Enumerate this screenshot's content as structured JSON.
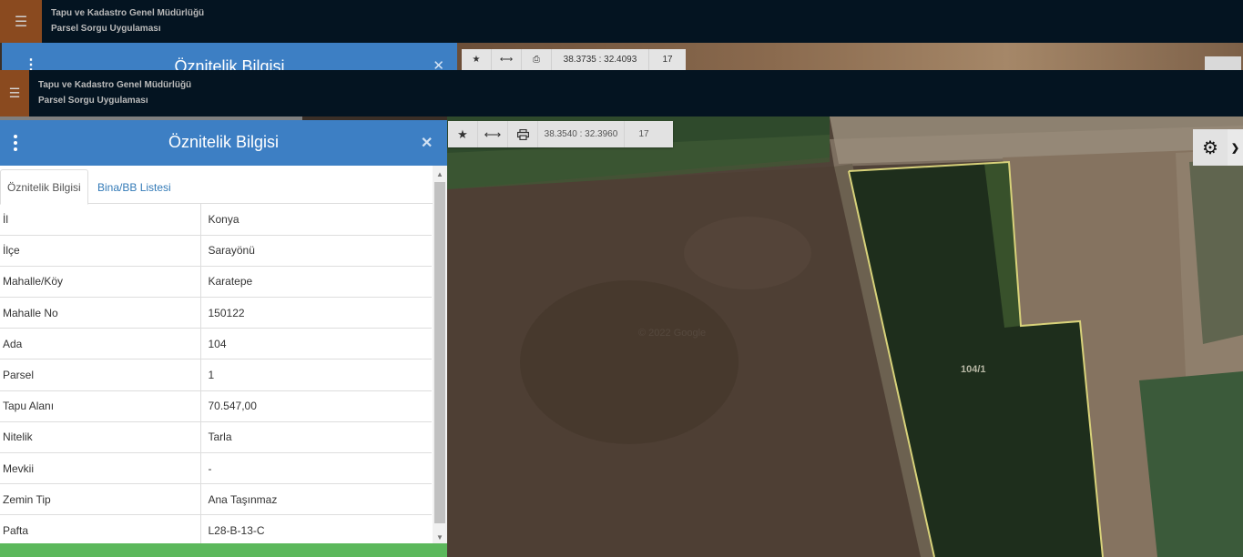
{
  "ghost": {
    "app_title_line1": "Tapu ve Kadastro Genel Müdürlüğü",
    "app_title_line2": "Parsel Sorgu Uygulaması",
    "panel_title": "Öznitelik Bilgisi",
    "coords": "38.3735 : 32.4093",
    "zoom": "17"
  },
  "header": {
    "menu_icon": "hamburger-icon",
    "title_line1": "Tapu ve Kadastro Genel Müdürlüğü",
    "title_line2": "Parsel Sorgu Uygulaması"
  },
  "toolbar": {
    "coords": "38.3540 : 32.3960",
    "zoom": "17",
    "icons": [
      "star-icon",
      "measure-icon",
      "print-icon"
    ]
  },
  "map": {
    "parcel_label": "104/1",
    "watermark": "© 2022 Google"
  },
  "panel": {
    "title": "Öznitelik Bilgisi",
    "tabs": [
      {
        "label": "Öznitelik Bilgisi",
        "active": true
      },
      {
        "label": "Bina/BB Listesi",
        "active": false
      }
    ],
    "rows": [
      {
        "key": "İl",
        "value": "Konya"
      },
      {
        "key": "İlçe",
        "value": "Sarayönü"
      },
      {
        "key": "Mahalle/Köy",
        "value": "Karatepe"
      },
      {
        "key": "Mahalle No",
        "value": "150122"
      },
      {
        "key": "Ada",
        "value": "104"
      },
      {
        "key": "Parsel",
        "value": "1"
      },
      {
        "key": "Tapu Alanı",
        "value": "70.547,00"
      },
      {
        "key": "Nitelik",
        "value": "Tarla"
      },
      {
        "key": "Mevkii",
        "value": "-"
      },
      {
        "key": "Zemin Tip",
        "value": "Ana Taşınmaz"
      },
      {
        "key": "Pafta",
        "value": "L28-B-13-C"
      }
    ]
  },
  "colors": {
    "header_bg": "#041421",
    "menu_bg": "#8a4a1f",
    "panel_header": "#3d7fc4",
    "footer_green": "#5cb85c",
    "parcel_outline": "#d8d27a"
  }
}
